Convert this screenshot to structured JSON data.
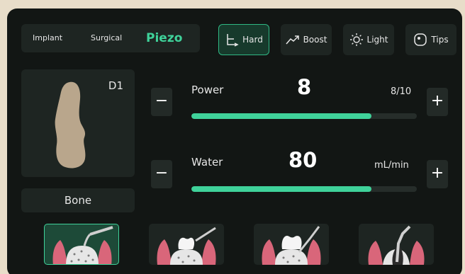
{
  "modes": {
    "items": [
      "Implant",
      "Surgical",
      "Piezo"
    ],
    "active": "Piezo"
  },
  "toolbar": {
    "hard_label": "Hard",
    "boost_label": "Boost",
    "light_label": "Light",
    "tips_label": "Tips"
  },
  "bone": {
    "density": "D1",
    "label": "Bone",
    "color": "#b9a68c"
  },
  "power": {
    "label": "Power",
    "value": "8",
    "range_text": "8/10",
    "level_fraction": 0.8,
    "decrease_label": "−",
    "increase_label": "+"
  },
  "water": {
    "label": "Water",
    "value": "80",
    "unit": "mL/min",
    "level_fraction": 0.8,
    "decrease_label": "−",
    "increase_label": "+"
  },
  "tips": {
    "items": [
      "implant-tip-icon",
      "crown-tip-icon",
      "molar-tip-icon",
      "root-tip-icon"
    ],
    "active_index": 0
  },
  "colors": {
    "accent": "#3fd29a",
    "panel": "#1e2522",
    "background": "#121614"
  }
}
